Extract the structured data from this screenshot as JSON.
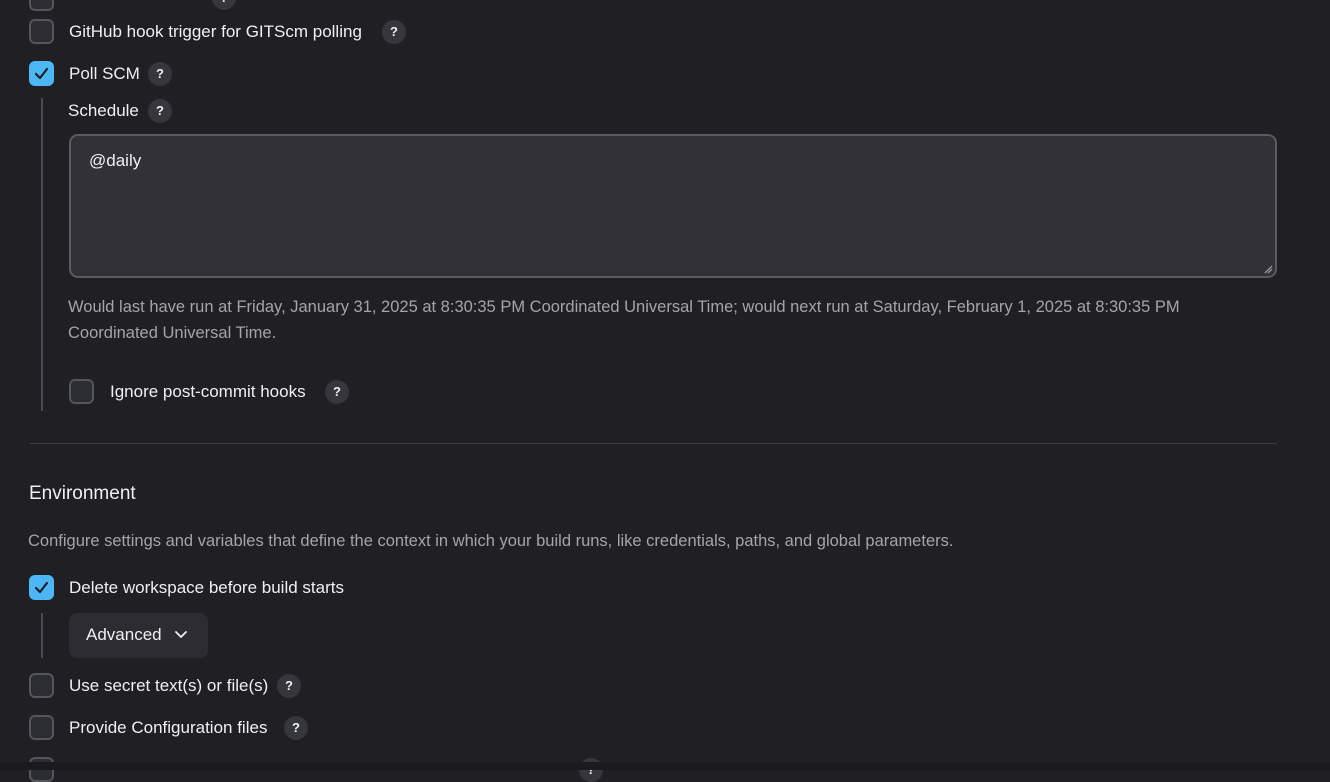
{
  "triggers": {
    "github_hook": {
      "label": "GitHub hook trigger for GITScm polling",
      "checked": false
    },
    "poll_scm": {
      "label": "Poll SCM",
      "checked": true
    }
  },
  "schedule": {
    "label": "Schedule",
    "value": "@daily",
    "info": "Would last have run at Friday, January 31, 2025 at 8:30:35 PM Coordinated Universal Time; would next run at Saturday, February 1, 2025 at 8:30:35 PM Coordinated Universal Time."
  },
  "ignore_hooks": {
    "label": "Ignore post-commit hooks",
    "checked": false
  },
  "environment": {
    "title": "Environment",
    "description": "Configure settings and variables that define the context in which your build runs, like credentials, paths, and global parameters.",
    "delete_workspace": {
      "label": "Delete workspace before build starts",
      "checked": true
    },
    "advanced_label": "Advanced",
    "secret": {
      "label": "Use secret text(s) or file(s)",
      "checked": false
    },
    "config_files": {
      "label": "Provide Configuration files",
      "checked": false
    }
  },
  "help_symbol": "?",
  "colors": {
    "accent": "#4bb7f5",
    "background": "#1f1f24"
  }
}
